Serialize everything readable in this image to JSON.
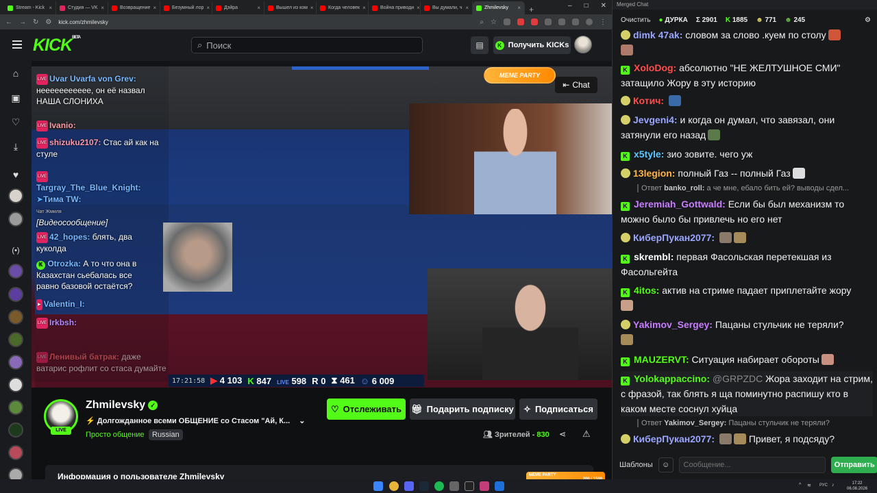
{
  "browser": {
    "tabs": [
      {
        "label": "Stream - Kick",
        "color": "#53fc18",
        "active": false
      },
      {
        "label": "Студия — VK",
        "color": "#e0245e",
        "active": false
      },
      {
        "label": "Возвращение",
        "color": "#ff0000",
        "active": false
      },
      {
        "label": "Безумный лор",
        "color": "#ff0000",
        "active": false
      },
      {
        "label": "Дэйра",
        "color": "#ff0000",
        "active": false
      },
      {
        "label": "Вышел из ком",
        "color": "#ff0000",
        "active": false
      },
      {
        "label": "Когда человек",
        "color": "#ff0000",
        "active": false
      },
      {
        "label": "Война приводи",
        "color": "#ff0000",
        "active": false
      },
      {
        "label": "Вы думали, ч",
        "color": "#ff0000",
        "active": false
      },
      {
        "label": "Zhmilevsky",
        "color": "#53fc18",
        "active": true
      }
    ],
    "url": "kick.com/zhmilevsky"
  },
  "header": {
    "logo": "KICK",
    "logo_badge": "BETA",
    "search_placeholder": "Поиск",
    "get_kicks": "Получить KICKs"
  },
  "video": {
    "chat_button": "Chat",
    "meme_party": "MEME PARTY",
    "overlay_chat": [
      {
        "name": "Uvar Uvarfa von Grev:",
        "text": "неееееееееее, он её назвал НАША СЛОНИХА",
        "color": "#7ab8ff"
      },
      {
        "name": "Ivanio:",
        "text": "",
        "color": "#ff9aa8"
      },
      {
        "name": "shizuku2107:",
        "text": "Стас ай как на стуле",
        "color": "#ff9aa8"
      },
      {
        "name": "Targray_The_Blue_Knight:",
        "text": "",
        "color": "#7ab8ff"
      },
      {
        "name": "Тима TW:",
        "text": "Чат Жмиля",
        "color": "#7ab8ff"
      },
      {
        "name": "",
        "text": "[Видеосообщение]",
        "color": "#ffffff"
      },
      {
        "name": "42_hopes:",
        "text": "блять, два куколда",
        "color": "#7ab8ff"
      },
      {
        "name": "Otrozka:",
        "text": "А то что она в Казахстан сьебалась все равно базовой остаётся?",
        "color": "#7ab8ff"
      },
      {
        "name": "Valentin_I:",
        "text": "",
        "color": "#7ab8ff"
      },
      {
        "name": "Irkbsh:",
        "text": "",
        "color": "#b08aff"
      },
      {
        "name": "Ленивый батрак:",
        "text": "даже ватарис рофлит со стаса думайте",
        "color": "#ff6a6a"
      }
    ],
    "stats": {
      "time": "17:21:58",
      "youtube": "4 103",
      "kick": "847",
      "vk": "598",
      "r": "0",
      "other": "461",
      "total": "6 009"
    }
  },
  "channel": {
    "name": "Zhmilevsky",
    "live": "LIVE",
    "title": "Долгожданное всеми ОБЩЕНИЕ со Стасом \"Ай, К...",
    "category": "Просто общение",
    "language": "Russian",
    "follow": "Отслеживать",
    "gift": "Подарить подписку",
    "subscribe": "Подписаться",
    "viewers_label": "Зрителей -",
    "viewers": "830",
    "about": "Информация о пользователе Zhmilevsky"
  },
  "chat_window": {
    "title": "Merged Chat",
    "clear": "Очистить",
    "stats": {
      "durka": "ДУРКА",
      "total": "Σ 2901",
      "kick": "1885",
      "other": "771",
      "third": "245"
    },
    "messages": [
      {
        "user": "dimk 47ak:",
        "color": "#9aa6ff",
        "text": "словом за слово .куем по столу",
        "icon": "emoji"
      },
      {
        "user": "XoloDog:",
        "color": "#ff4d4d",
        "text": "абсолютно \"НЕ ЖЕЛТУШНОЕ СМИ\" затащило Жору в эту историю",
        "icon": "kick"
      },
      {
        "user": "Котич:",
        "color": "#ff4d4d",
        "text": "",
        "icon": "emoji"
      },
      {
        "user": "Jevgeni4:",
        "color": "#9aa6ff",
        "text": "и когда он думал, что завязал, они затянули его назад",
        "icon": "emoji"
      },
      {
        "user": "x5tyle:",
        "color": "#5fc7ff",
        "text": "зио зовите. чего уж",
        "icon": "kick"
      },
      {
        "user": "13legion:",
        "color": "#ffb347",
        "text": "полный  Газ  -- полный Газ",
        "icon": "emoji"
      },
      {
        "user": "Jeremiah_Gottwald:",
        "color": "#c77dff",
        "text": "Если бы был механизм то можно было бы привлечь но его нет",
        "icon": "kick"
      },
      {
        "user": "КиберПукан2077:",
        "color": "#9aa6ff",
        "text": "",
        "icon": "emoji"
      },
      {
        "user": "skrembl:",
        "color": "#ffffff",
        "text": "первая Фасольская перетекшая из Фасольгейта",
        "icon": "kick"
      },
      {
        "user": "4itos:",
        "color": "#53fc18",
        "text": "актив на стриме падает приплетайте жору",
        "icon": "kick"
      },
      {
        "user": "Yakimov_Sergey:",
        "color": "#c77dff",
        "text": "Пацаны стульчик не теряли?",
        "icon": "emoji"
      },
      {
        "user": "MAUZERVT:",
        "color": "#53fc18",
        "text": "Ситуация набирает обороты",
        "icon": "kick"
      },
      {
        "user": "Yolokappaccino:",
        "color": "#53fc18",
        "text": "Жора заходит на стрим, с фразой, так блять я ща поминутно распишу кто в каком месте соснул хуйца",
        "mention": "@GRPZDC",
        "icon": "kick"
      },
      {
        "user": "КиберПукан2077:",
        "color": "#9aa6ff",
        "text": "Привет, я подсяду?",
        "icon": "emoji"
      }
    ],
    "replies": [
      {
        "label": "Ответ",
        "user": "banko_roll:",
        "text": "а че мне, ебало бить ей? выводы сдел..."
      },
      {
        "label": "Ответ",
        "user": "Yakimov_Sergey:",
        "text": "Пацаны стульчик не теряли?"
      }
    ],
    "templates": "Шаблоны",
    "input_placeholder": "Сообщение...",
    "send": "Отправить"
  },
  "taskbar": {
    "lang": "РУС",
    "time": "17:22",
    "date": "06.08.2026",
    "meme": "MEME PARTY",
    "meme_count": "200 / 1500"
  }
}
